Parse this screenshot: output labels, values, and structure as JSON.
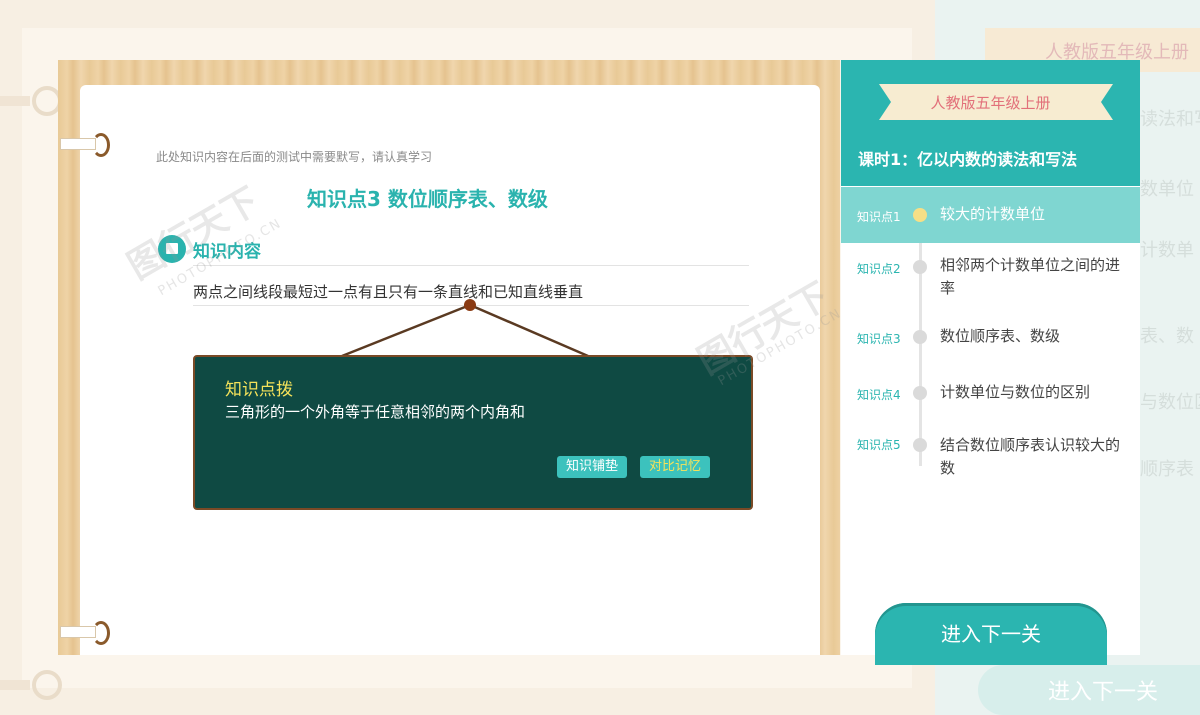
{
  "page": {
    "note": "此处知识内容在后面的测试中需要默写，请认真学习",
    "title": "知识点3  数位顺序表、数级",
    "section_title": "知识内容",
    "fact": "两点之间线段最短过一点有且只有一条直线和已知直线垂直"
  },
  "tip": {
    "title": "知识点拨",
    "body": "三角形的一个外角等于任意相邻的两个内角和",
    "buttons": [
      "知识铺垫",
      "对比记忆"
    ]
  },
  "sidebar": {
    "ribbon": "人教版五年级上册",
    "lesson": "课时1：亿以内数的读法和写法",
    "items": [
      {
        "tag": "知识点1",
        "label": "较大的计数单位",
        "active": true
      },
      {
        "tag": "知识点2",
        "label": "相邻两个计数单位之间的进率",
        "active": false
      },
      {
        "tag": "知识点3",
        "label": "数位顺序表、数级",
        "active": false
      },
      {
        "tag": "知识点4",
        "label": "计数单位与数位的区别",
        "active": false
      },
      {
        "tag": "知识点5",
        "label": "结合数位顺序表认识较大的数",
        "active": false
      }
    ],
    "next_button": "进入下一关"
  },
  "background_ghost": {
    "ribbon": "人教版五年级上册",
    "fragments": [
      "读法和写",
      "数单位",
      "计数单",
      "表、数",
      "与数位区",
      "顺序表"
    ],
    "next_button": "进入下一关"
  },
  "watermark": {
    "brand": "图行天下",
    "domain": "PHOTOPHOTO.CN"
  },
  "colors": {
    "teal": "#2bb5b0",
    "board_green": "#0f4a43",
    "tip_title": "#f4e25a",
    "ribbon_text": "#e2707a"
  }
}
